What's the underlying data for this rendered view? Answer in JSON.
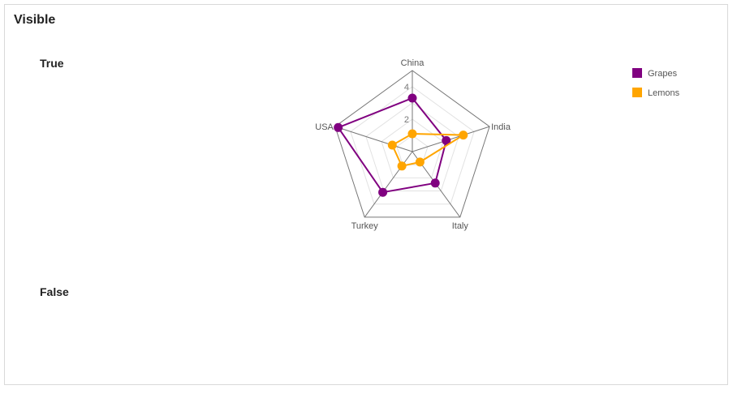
{
  "page": {
    "title": "Visible",
    "section_true": "True",
    "section_false": "False"
  },
  "chart_data": {
    "type": "radar",
    "categories": [
      "China",
      "India",
      "Italy",
      "Turkey",
      "USA"
    ],
    "ticks": [
      2,
      4
    ],
    "range": [
      0,
      5
    ],
    "grid": true,
    "legend_position": "top-right",
    "series": [
      {
        "name": "Grapes",
        "color": "#800080",
        "values": [
          3.3,
          2.2,
          2.4,
          3.1,
          4.8
        ]
      },
      {
        "name": "Lemons",
        "color": "#FFA500",
        "values": [
          1.1,
          3.3,
          0.8,
          1.1,
          1.3
        ]
      }
    ]
  }
}
